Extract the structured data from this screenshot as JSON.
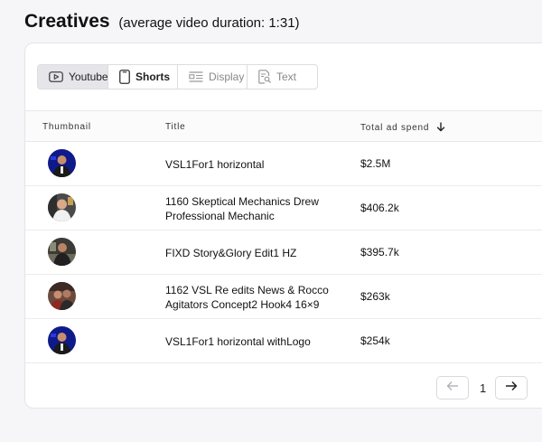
{
  "header": {
    "title": "Creatives",
    "subtitle": "(average video duration: 1:31)"
  },
  "tabs": [
    {
      "label": "Youtube",
      "icon": "video-play-icon",
      "state": "active"
    },
    {
      "label": "Shorts",
      "icon": "phone-icon",
      "state": "selected"
    },
    {
      "label": "Display",
      "icon": "display-layout-icon",
      "state": "normal"
    },
    {
      "label": "Text",
      "icon": "text-search-icon",
      "state": "normal"
    }
  ],
  "table": {
    "columns": {
      "thumbnail": "Thumbnail",
      "title": "Title",
      "spend": "Total ad spend"
    },
    "sort_icon": "arrow-down-icon",
    "rows": [
      {
        "title": "VSL1For1 horizontal",
        "spend": "$2.5M"
      },
      {
        "title": "1160 Skeptical Mechanics Drew Professional Mechanic",
        "spend": "$406.2k"
      },
      {
        "title": "FIXD Story&Glory Edit1 HZ",
        "spend": "$395.7k"
      },
      {
        "title": "1162 VSL Re edits News & Rocco Agitators Concept2 Hook4 16×9",
        "spend": "$263k"
      },
      {
        "title": "VSL1For1 horizontal withLogo",
        "spend": "$254k"
      }
    ]
  },
  "pagination": {
    "page": "1",
    "prev_icon": "arrow-left-icon",
    "next_icon": "arrow-right-icon"
  },
  "colors": {
    "active_tab_bg": "#e5e5ea",
    "border": "#e5e5ea",
    "page_bg": "#f6f6f8"
  }
}
